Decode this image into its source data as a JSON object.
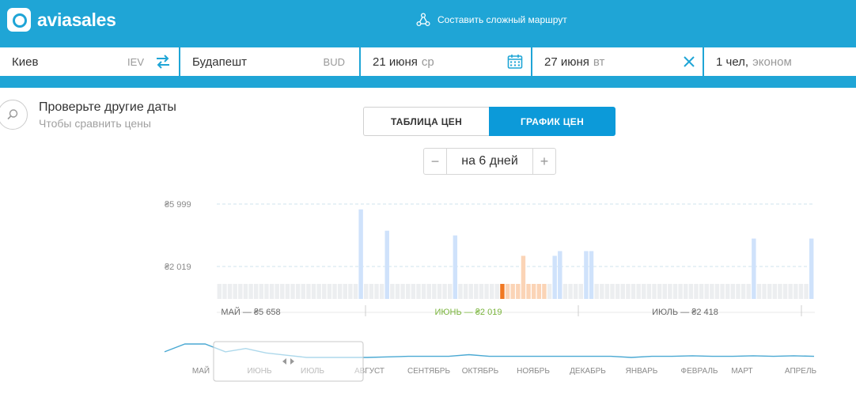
{
  "header": {
    "logo_text": "aviasales",
    "complex_route_label": "Составить сложный маршрут"
  },
  "search": {
    "origin": {
      "city": "Киев",
      "code": "IEV"
    },
    "destination": {
      "city": "Будапешт",
      "code": "BUD"
    },
    "depart": {
      "date": "21 июня",
      "weekday": "ср"
    },
    "return": {
      "date": "27 июня",
      "weekday": "вт"
    },
    "passengers": {
      "count": "1 чел,",
      "class": "эконом"
    }
  },
  "colors": {
    "brand": "#1fa5d6",
    "tab_active": "#0c9ad9",
    "bar_selected": "#f07822",
    "bar_range": "#fbd4b6",
    "bar_light": "#cfe2fb",
    "bar_empty": "#eceef0",
    "month_active": "#79b43b",
    "line": "#4aa9d3"
  },
  "check_dates": {
    "title": "Проверьте другие даты",
    "subtitle": "Чтобы сравнить цены"
  },
  "tabs": {
    "table_label": "ТАБЛИЦА ЦЕН",
    "chart_label": "ГРАФИК ЦЕН"
  },
  "stepper": {
    "minus": "−",
    "value": "на 6 дней",
    "plus": "+"
  },
  "chart_data": {
    "type": "bar",
    "y_ticks": [
      "₴5 999",
      "₴2 019"
    ],
    "y_tick_values": [
      5999,
      2019
    ],
    "bars": [
      0,
      0,
      0,
      0,
      0,
      0,
      0,
      0,
      0,
      0,
      0,
      0,
      0,
      0,
      0,
      0,
      0,
      0,
      0,
      0,
      0,
      0,
      0,
      0,
      0,
      0,
      0,
      0,
      0,
      0,
      0,
      0,
      0,
      0,
      0,
      0,
      0,
      0,
      0,
      0,
      0,
      0,
      0,
      0,
      0,
      0,
      0,
      0,
      0,
      0,
      0,
      0,
      0,
      0,
      0,
      0,
      0,
      0,
      0,
      0,
      0,
      0,
      0,
      0,
      0,
      0,
      0,
      0,
      0,
      0,
      0,
      0,
      0,
      0,
      0,
      0,
      0,
      0,
      0,
      0,
      0,
      0,
      0,
      0,
      0,
      0,
      0,
      0,
      0,
      0,
      0,
      0,
      0,
      0,
      0,
      0,
      0,
      0,
      0,
      0,
      0,
      0,
      0,
      0,
      0,
      0,
      0,
      0,
      0,
      0,
      0,
      0,
      0,
      0,
      0,
      0,
      0,
      0,
      0,
      0,
      0,
      0,
      0,
      0,
      0,
      0,
      0,
      0,
      0,
      0,
      0,
      0,
      0,
      0,
      0,
      0,
      0,
      0,
      0,
      0,
      0,
      0,
      0,
      0,
      0,
      0,
      0,
      0,
      0,
      0,
      0,
      0,
      0,
      0,
      0,
      0,
      0,
      0,
      0,
      0,
      0,
      0,
      0,
      0,
      0,
      0,
      0,
      0,
      0,
      0,
      0,
      0,
      0,
      0,
      0,
      0,
      0,
      0,
      0,
      0,
      0,
      0,
      0,
      0,
      0,
      0,
      0,
      0,
      0,
      0,
      0,
      0,
      0,
      0,
      0,
      0,
      0,
      0,
      0,
      0,
      0,
      0,
      0,
      0,
      0,
      0,
      0,
      0,
      0,
      0,
      0,
      0,
      0,
      0,
      0,
      0,
      0,
      0,
      0,
      0,
      0,
      0,
      0,
      0,
      0,
      0,
      0,
      0,
      0,
      0,
      0,
      0,
      0,
      0,
      0,
      0,
      0,
      0,
      0,
      0,
      0,
      0,
      0,
      0,
      0,
      0,
      0,
      0,
      0,
      0,
      0,
      0,
      0,
      0,
      0,
      0,
      0,
      0,
      0,
      0,
      0,
      0,
      0,
      0,
      0,
      0,
      0,
      0,
      0,
      0,
      0,
      0,
      0,
      0,
      0,
      0,
      0,
      0,
      0,
      0,
      0,
      0,
      0,
      0,
      0,
      0,
      0,
      0,
      0,
      0,
      0,
      0,
      0,
      0,
      0,
      0,
      0,
      0,
      0,
      0,
      0,
      0,
      0,
      0,
      0,
      0,
      0,
      0,
      0,
      0,
      0,
      0,
      0,
      0,
      0,
      0,
      0,
      0,
      0,
      0,
      0,
      0,
      0,
      0,
      0,
      0,
      0,
      0,
      0,
      0,
      0,
      0,
      0,
      0,
      0,
      0,
      0,
      0,
      0,
      0,
      0,
      0,
      0,
      0,
      0,
      0,
      0,
      0,
      0,
      0,
      0,
      0,
      0,
      0,
      0,
      0,
      0,
      0,
      0,
      0,
      0,
      0,
      0,
      0,
      0,
      0,
      0,
      0,
      0,
      0,
      0,
      0
    ],
    "days": [
      {
        "v": 1100,
        "s": "e"
      },
      {
        "v": 1100,
        "s": "e"
      },
      {
        "v": 1100,
        "s": "e"
      },
      {
        "v": 1100,
        "s": "e"
      },
      {
        "v": 1100,
        "s": "e"
      },
      {
        "v": 1100,
        "s": "e"
      },
      {
        "v": 1100,
        "s": "e"
      },
      {
        "v": 1100,
        "s": "e"
      },
      {
        "v": 1100,
        "s": "e"
      },
      {
        "v": 1100,
        "s": "e"
      },
      {
        "v": 1100,
        "s": "e"
      },
      {
        "v": 1100,
        "s": "e"
      },
      {
        "v": 1100,
        "s": "e"
      },
      {
        "v": 1100,
        "s": "e"
      },
      {
        "v": 1100,
        "s": "e"
      },
      {
        "v": 1100,
        "s": "e"
      },
      {
        "v": 1100,
        "s": "e"
      },
      {
        "v": 1100,
        "s": "e"
      },
      {
        "v": 1100,
        "s": "e"
      },
      {
        "v": 1100,
        "s": "e"
      },
      {
        "v": 1100,
        "s": "e"
      },
      {
        "v": 1100,
        "s": "e"
      },
      {
        "v": 1100,
        "s": "e"
      },
      {
        "v": 1100,
        "s": "e"
      },
      {
        "v": 1100,
        "s": "e"
      },
      {
        "v": 1100,
        "s": "e"
      },
      {
        "v": 1100,
        "s": "e"
      },
      {
        "v": 5658,
        "s": "l"
      },
      {
        "v": 1100,
        "s": "e"
      },
      {
        "v": 1100,
        "s": "e"
      },
      {
        "v": 1100,
        "s": "e"
      },
      {
        "v": 1100,
        "s": "e"
      },
      {
        "v": 4300,
        "s": "l"
      },
      {
        "v": 1100,
        "s": "e"
      },
      {
        "v": 1100,
        "s": "e"
      },
      {
        "v": 1100,
        "s": "e"
      },
      {
        "v": 1100,
        "s": "e"
      },
      {
        "v": 1100,
        "s": "e"
      },
      {
        "v": 1100,
        "s": "e"
      },
      {
        "v": 1100,
        "s": "e"
      },
      {
        "v": 1100,
        "s": "e"
      },
      {
        "v": 1100,
        "s": "e"
      },
      {
        "v": 1100,
        "s": "e"
      },
      {
        "v": 1100,
        "s": "e"
      },
      {
        "v": 1100,
        "s": "e"
      },
      {
        "v": 4000,
        "s": "l"
      },
      {
        "v": 1100,
        "s": "e"
      },
      {
        "v": 1100,
        "s": "e"
      },
      {
        "v": 1100,
        "s": "e"
      },
      {
        "v": 1100,
        "s": "e"
      },
      {
        "v": 1100,
        "s": "e"
      },
      {
        "v": 1100,
        "s": "e"
      },
      {
        "v": 1100,
        "s": "e"
      },
      {
        "v": 1100,
        "s": "e"
      },
      {
        "v": 2019,
        "s": "sel"
      },
      {
        "v": 1100,
        "s": "r"
      },
      {
        "v": 1100,
        "s": "r"
      },
      {
        "v": 1100,
        "s": "r"
      },
      {
        "v": 2700,
        "s": "r"
      },
      {
        "v": 1100,
        "s": "r"
      },
      {
        "v": 1100,
        "s": "r"
      },
      {
        "v": 1100,
        "s": "r"
      },
      {
        "v": 1100,
        "s": "r"
      },
      {
        "v": 1100,
        "s": "e"
      },
      {
        "v": 2700,
        "s": "l"
      },
      {
        "v": 3000,
        "s": "l"
      },
      {
        "v": 1100,
        "s": "e"
      },
      {
        "v": 1100,
        "s": "e"
      },
      {
        "v": 1100,
        "s": "e"
      },
      {
        "v": 1100,
        "s": "e"
      },
      {
        "v": 3000,
        "s": "l"
      },
      {
        "v": 3000,
        "s": "l"
      },
      {
        "v": 1100,
        "s": "e"
      },
      {
        "v": 1100,
        "s": "e"
      },
      {
        "v": 1100,
        "s": "e"
      },
      {
        "v": 1100,
        "s": "e"
      },
      {
        "v": 1100,
        "s": "e"
      },
      {
        "v": 1100,
        "s": "e"
      },
      {
        "v": 1100,
        "s": "e"
      },
      {
        "v": 1100,
        "s": "e"
      },
      {
        "v": 1100,
        "s": "e"
      },
      {
        "v": 1100,
        "s": "e"
      },
      {
        "v": 1100,
        "s": "e"
      },
      {
        "v": 1100,
        "s": "e"
      },
      {
        "v": 1100,
        "s": "e"
      },
      {
        "v": 1100,
        "s": "e"
      },
      {
        "v": 1100,
        "s": "e"
      },
      {
        "v": 1100,
        "s": "e"
      },
      {
        "v": 1100,
        "s": "e"
      },
      {
        "v": 1100,
        "s": "e"
      },
      {
        "v": 1100,
        "s": "e"
      },
      {
        "v": 1100,
        "s": "e"
      },
      {
        "v": 1100,
        "s": "e"
      },
      {
        "v": 1100,
        "s": "e"
      },
      {
        "v": 1100,
        "s": "e"
      },
      {
        "v": 1100,
        "s": "e"
      },
      {
        "v": 1100,
        "s": "e"
      },
      {
        "v": 1100,
        "s": "e"
      },
      {
        "v": 1100,
        "s": "e"
      },
      {
        "v": 1100,
        "s": "e"
      },
      {
        "v": 1100,
        "s": "e"
      },
      {
        "v": 1100,
        "s": "e"
      },
      {
        "v": 3800,
        "s": "l"
      },
      {
        "v": 1100,
        "s": "e"
      },
      {
        "v": 1100,
        "s": "e"
      },
      {
        "v": 1100,
        "s": "e"
      },
      {
        "v": 1100,
        "s": "e"
      },
      {
        "v": 1100,
        "s": "e"
      },
      {
        "v": 1100,
        "s": "e"
      },
      {
        "v": 1100,
        "s": "e"
      },
      {
        "v": 1100,
        "s": "e"
      },
      {
        "v": 1100,
        "s": "e"
      },
      {
        "v": 1100,
        "s": "e"
      },
      {
        "v": 3800,
        "s": "l"
      }
    ],
    "month_summaries": [
      {
        "label": "МАЙ — ₴5 658",
        "active": false
      },
      {
        "label": "ИЮНЬ — ₴2 019",
        "active": true
      },
      {
        "label": "ИЮЛЬ — ₴2 418",
        "active": false
      }
    ],
    "overview_months": [
      "МАЙ",
      "ИЮНЬ",
      "ИЮЛЬ",
      "АВГУСТ",
      "СЕНТЯБРЬ",
      "ОКТЯБРЬ",
      "НОЯБРЬ",
      "ДЕКАБРЬ",
      "ЯНВАРЬ",
      "ФЕВРАЛЬ",
      "МАРТ",
      "АПРЕЛЬ"
    ],
    "overview_line": [
      3000,
      3700,
      3700,
      3000,
      3300,
      2900,
      2700,
      2500,
      2500,
      2500,
      2500,
      2550,
      2600,
      2600,
      2600,
      2750,
      2600,
      2600,
      2600,
      2600,
      2600,
      2600,
      2600,
      2500,
      2600,
      2600,
      2650,
      2600,
      2600,
      2650,
      2600,
      2650,
      2600
    ],
    "window_months": [
      "ИЮНЬ",
      "ИЮЛЬ"
    ]
  }
}
